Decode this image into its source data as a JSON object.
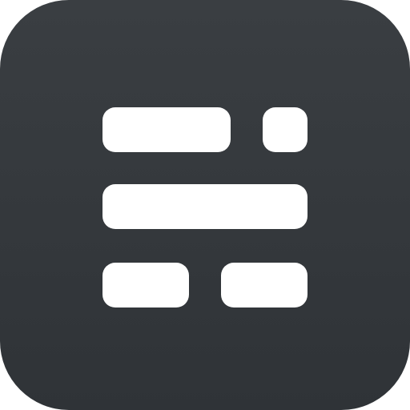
{
  "app_icon": {
    "icon_name": "form-layout-icon",
    "background_color": "#35393d",
    "glyph_color": "#ffffff"
  }
}
